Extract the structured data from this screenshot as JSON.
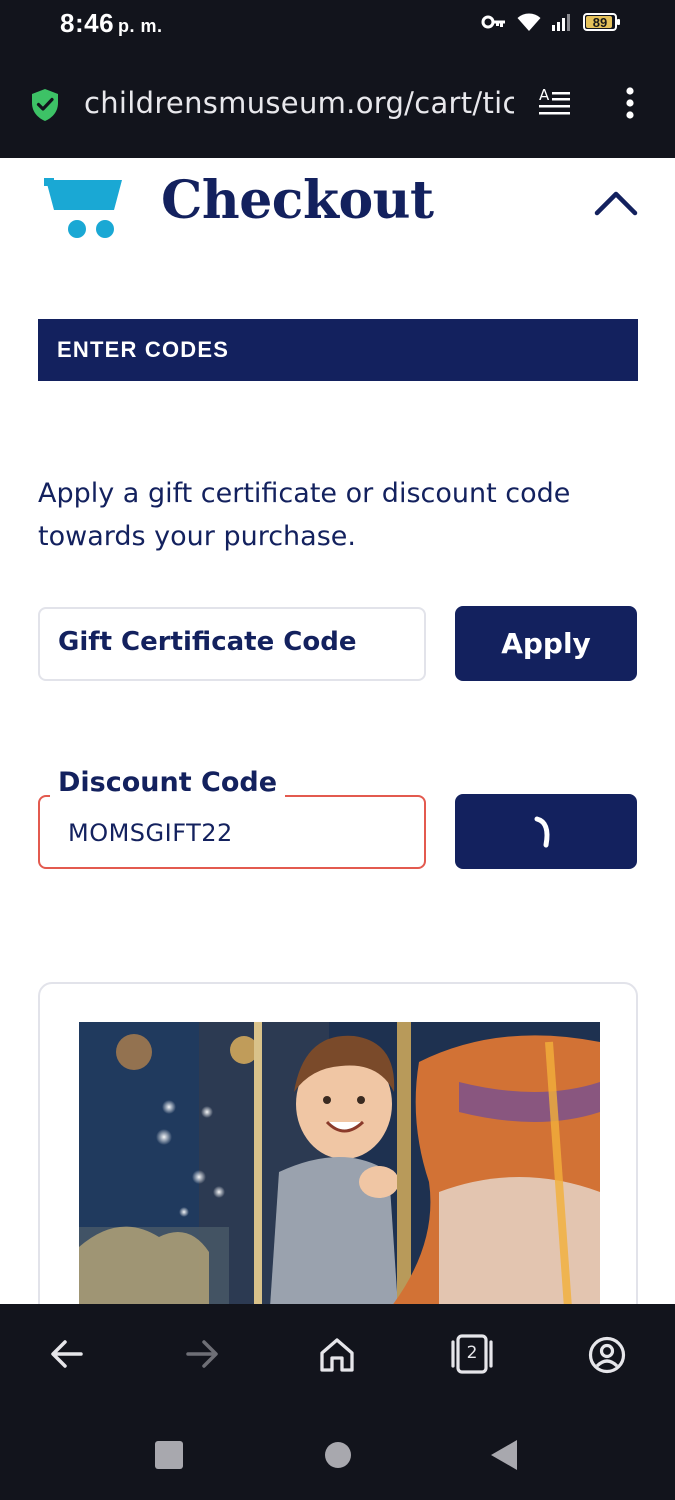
{
  "status_bar": {
    "time": "8:46",
    "time_suffix": "p. m.",
    "battery": "89",
    "icons": [
      "vpn-key-icon",
      "wifi-icon",
      "signal-icon",
      "battery-icon"
    ]
  },
  "browser": {
    "url": "childrensmuseum.org/cart/tic",
    "secure_icon": "shield-check-icon",
    "reader_icon": "reader-mode-icon",
    "menu_icon": "more-vert-icon",
    "tab_count": "2"
  },
  "checkout": {
    "title": "Checkout",
    "section_title": "ENTER CODES",
    "intro": "Apply a gift certificate or discount code towards your purchase.",
    "gift_placeholder": "Gift Certificate Code",
    "apply_label": "Apply",
    "discount_label": "Discount Code",
    "discount_value": "MOMSGIFT22"
  },
  "colors": {
    "navy": "#13215e",
    "accent_cyan": "#1aa8d4",
    "error_red": "#e35a4f",
    "chrome_dark": "#12141c"
  }
}
